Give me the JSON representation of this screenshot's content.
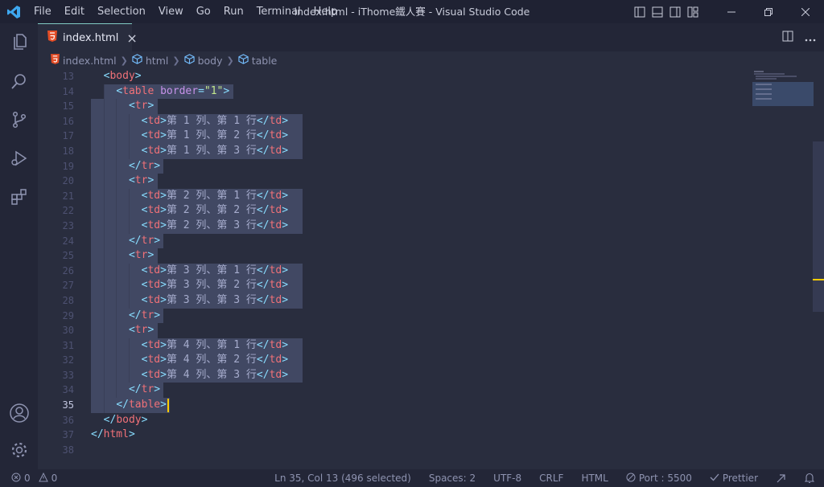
{
  "window": {
    "title": "index.html - iThome鐵人賽 - Visual Studio Code"
  },
  "menu": [
    "File",
    "Edit",
    "Selection",
    "View",
    "Go",
    "Run",
    "Terminal",
    "Help"
  ],
  "activity_bar": {
    "top": [
      "files-icon",
      "search-icon",
      "source-control-icon",
      "run-debug-icon",
      "extensions-icon"
    ],
    "bottom": [
      "account-icon",
      "settings-gear-icon"
    ]
  },
  "tab": {
    "label": "index.html",
    "close_glyph": "×"
  },
  "breadcrumb": [
    "index.html",
    "html",
    "body",
    "table"
  ],
  "editor": {
    "line_numbers": [
      "13",
      "14",
      "15",
      "16",
      "17",
      "18",
      "19",
      "20",
      "21",
      "22",
      "23",
      "24",
      "25",
      "26",
      "27",
      "28",
      "29",
      "30",
      "31",
      "32",
      "33",
      "34",
      "35",
      "36",
      "37",
      "38"
    ],
    "active_line": "35",
    "lines": [
      "  <body>",
      "    <table border=\"1\">",
      "      <tr>",
      "        <td>第 1 列、第 1 行</td>",
      "        <td>第 1 列、第 2 行</td>",
      "        <td>第 1 列、第 3 行</td>",
      "      </tr>",
      "      <tr>",
      "        <td>第 2 列、第 1 行</td>",
      "        <td>第 2 列、第 2 行</td>",
      "        <td>第 2 列、第 3 行</td>",
      "      </tr>",
      "      <tr>",
      "        <td>第 3 列、第 1 行</td>",
      "        <td>第 3 列、第 2 行</td>",
      "        <td>第 3 列、第 3 行</td>",
      "      </tr>",
      "      <tr>",
      "        <td>第 4 列、第 1 行</td>",
      "        <td>第 4 列、第 2 行</td>",
      "        <td>第 4 列、第 3 行</td>",
      "      </tr>",
      "    </table>",
      "  </body>",
      "</html>",
      ""
    ]
  },
  "status": {
    "errors": "0",
    "warnings": "0",
    "position": "Ln 35, Col 13 (496 selected)",
    "spaces": "Spaces: 2",
    "encoding": "UTF-8",
    "eol": "CRLF",
    "language": "HTML",
    "port": "Port : 5500",
    "prettier": "Prettier"
  },
  "colors": {
    "accent": "#80cbc4",
    "cursor": "#ffcc00",
    "tag": "#f07178",
    "punct": "#89ddff",
    "attr": "#c792ea",
    "string": "#c3e88d",
    "html_icon": "#e44d26"
  }
}
